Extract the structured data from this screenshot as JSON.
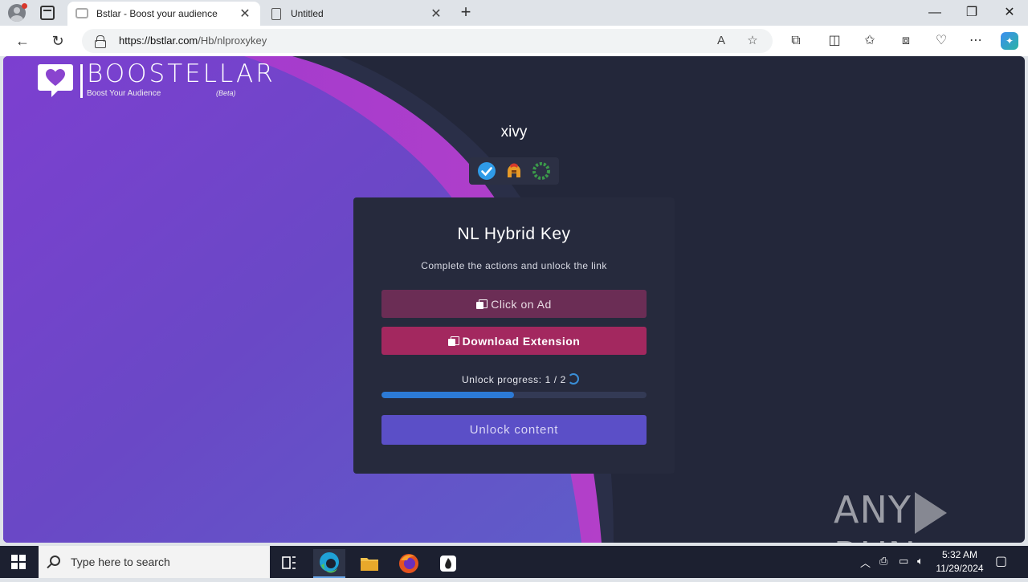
{
  "browser": {
    "tabs": [
      {
        "label": "Bstlar - Boost your audience",
        "active": true
      },
      {
        "label": "Untitled",
        "active": false
      }
    ],
    "new_tab_label": "+",
    "url_host": "https://bstlar.com",
    "url_path": "/Hb/nlproxykey",
    "window_controls": {
      "minimize": "—",
      "restore": "❐",
      "close": "✕"
    }
  },
  "logo": {
    "wordmark": "BOOSTELLAR",
    "tagline": "Boost Your Audience",
    "beta": "(Beta)"
  },
  "profile": {
    "username": "xivy",
    "badges": [
      "verified-icon",
      "helmet-icon",
      "wreath-icon"
    ]
  },
  "card": {
    "title": "NL Hybrid Key",
    "subtitle": "Complete the actions and unlock the link",
    "actions": [
      {
        "label": "Click on Ad"
      },
      {
        "label": "Download Extension"
      }
    ],
    "progress_label": "Unlock progress: 1 / 2",
    "progress_fraction": 0.5,
    "unlock_label": "Unlock content"
  },
  "watermark": {
    "left": "ANY",
    "right": "RUN"
  },
  "colors": {
    "page_bg": "#23273a",
    "purple_wave": "#6f46c8",
    "ad_button": "#6b2d55",
    "extension_button": "#a3285f",
    "unlock_button": "#5b4fc7",
    "progress": "#2c7ad6"
  },
  "taskbar": {
    "search_placeholder": "Type here to search",
    "time": "5:32 AM",
    "date": "11/29/2024"
  }
}
